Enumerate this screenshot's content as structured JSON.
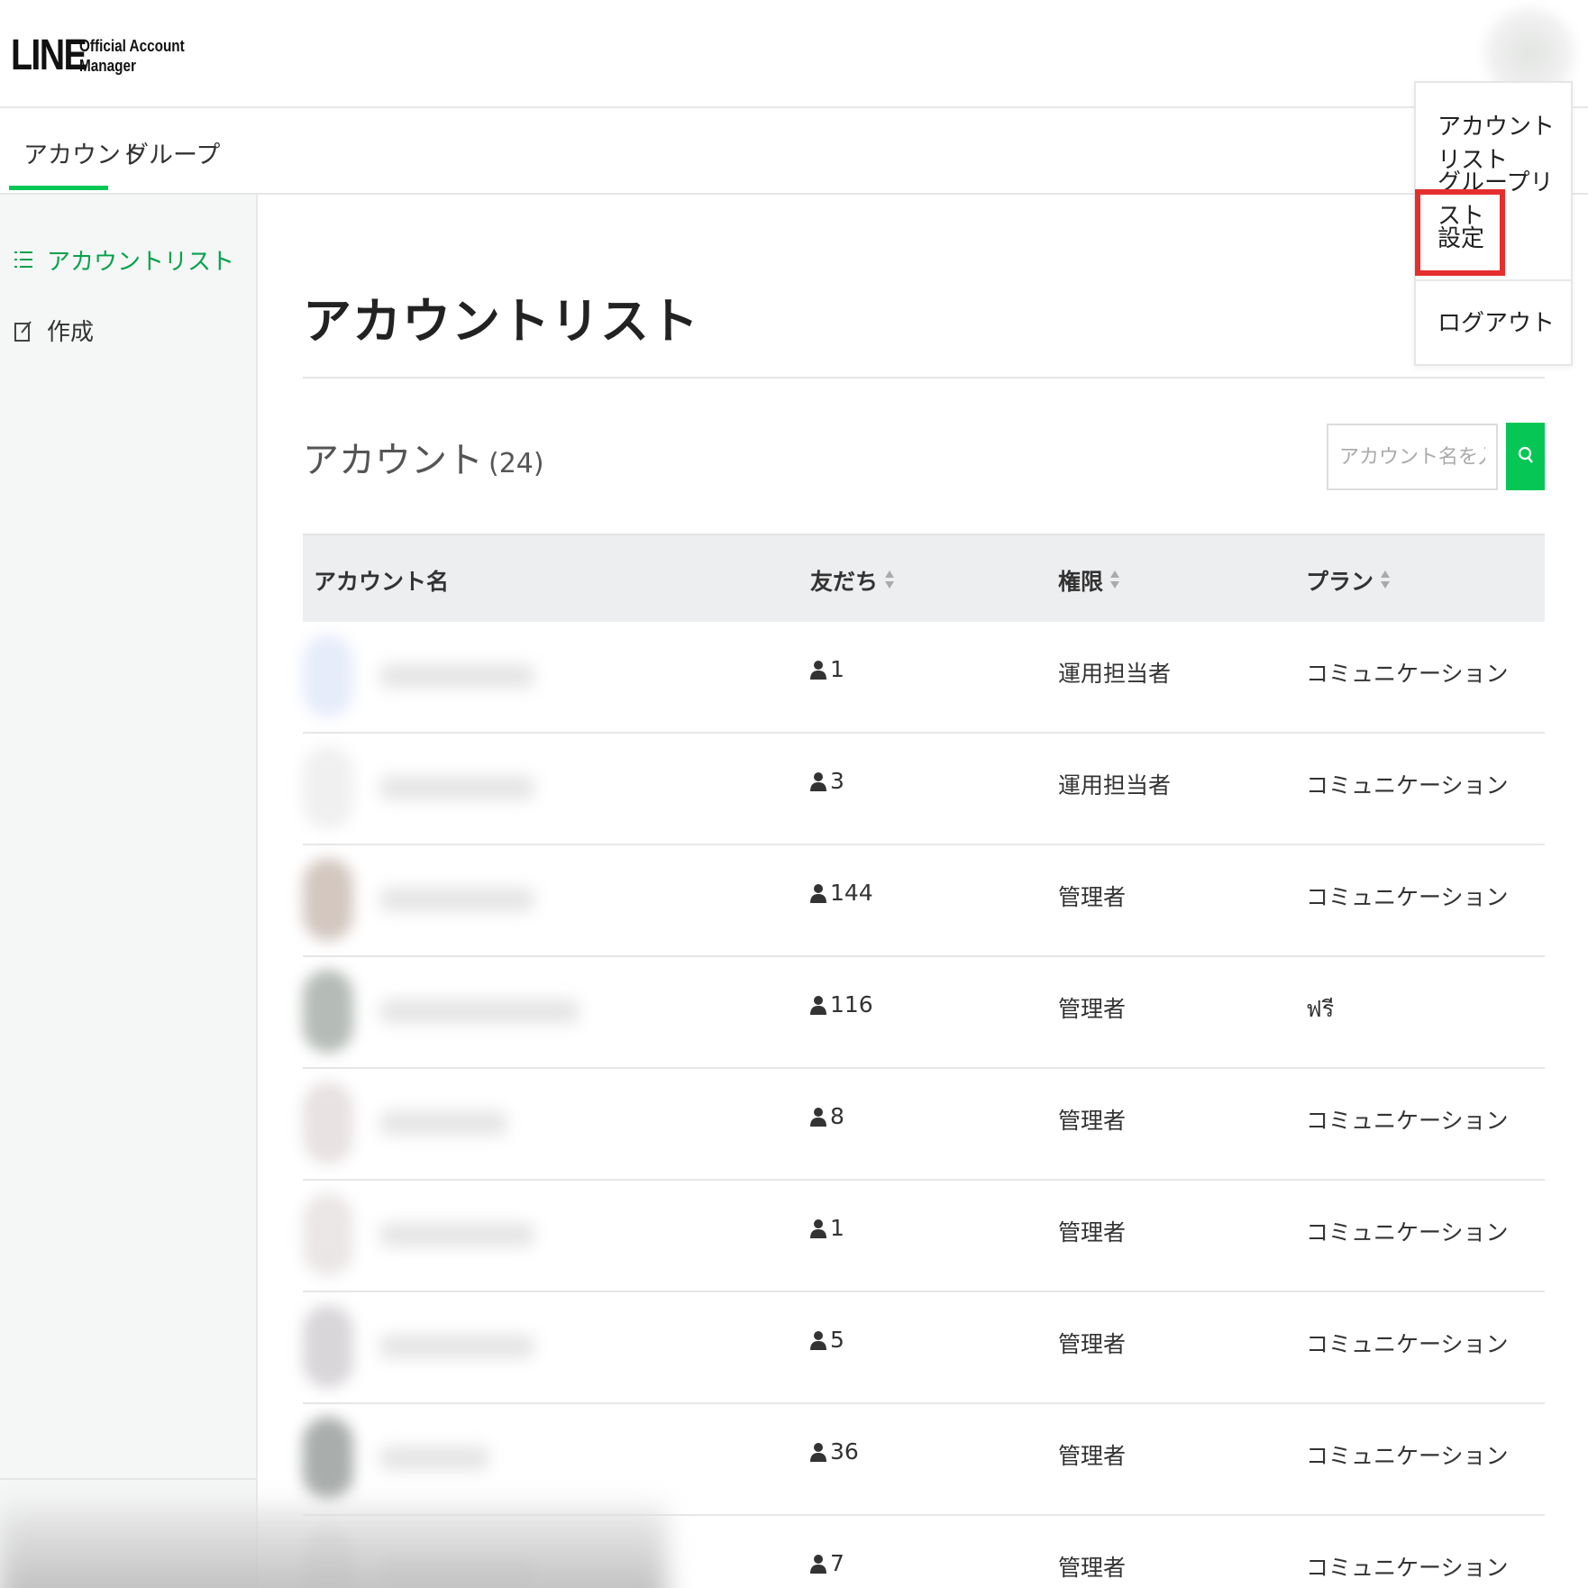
{
  "header": {
    "logo_main": "LINE",
    "logo_sub_1": "Official Account",
    "logo_sub_2": "Manager"
  },
  "tabs": [
    {
      "label": "アカウント",
      "active": true
    },
    {
      "label": "グループ",
      "active": false
    }
  ],
  "sidebar": {
    "items": [
      {
        "label": "アカウントリスト",
        "icon": "list-icon",
        "active": true
      },
      {
        "label": "作成",
        "icon": "edit-icon",
        "active": false
      }
    ]
  },
  "main": {
    "title": "アカウントリスト",
    "section_title": "アカウント",
    "section_count": "(24)",
    "search": {
      "placeholder": "アカウント名を入力",
      "value": ""
    }
  },
  "table": {
    "columns": [
      "アカウント名",
      "友だち",
      "権限",
      "プラン"
    ],
    "rows": [
      {
        "friends": "1",
        "role": "運用担当者",
        "plan": "コミュニケーション"
      },
      {
        "friends": "3",
        "role": "運用担当者",
        "plan": "コミュニケーション"
      },
      {
        "friends": "144",
        "role": "管理者",
        "plan": "コミュニケーション"
      },
      {
        "friends": "116",
        "role": "管理者",
        "plan": "ฟรี"
      },
      {
        "friends": "8",
        "role": "管理者",
        "plan": "コミュニケーション"
      },
      {
        "friends": "1",
        "role": "管理者",
        "plan": "コミュニケーション"
      },
      {
        "friends": "5",
        "role": "管理者",
        "plan": "コミュニケーション"
      },
      {
        "friends": "36",
        "role": "管理者",
        "plan": "コミュニケーション"
      },
      {
        "friends": "7",
        "role": "管理者",
        "plan": "コミュニケーション"
      }
    ]
  },
  "menu": {
    "items": [
      "アカウントリスト",
      "グループリスト",
      "設定",
      "ログアウト"
    ],
    "highlighted": "設定"
  },
  "colors": {
    "accent": "#06c755",
    "active_text": "#06a24c",
    "highlight": "#e52e2e",
    "table_header_bg": "#edeef0",
    "sidebar_bg": "#f5f6f6"
  }
}
